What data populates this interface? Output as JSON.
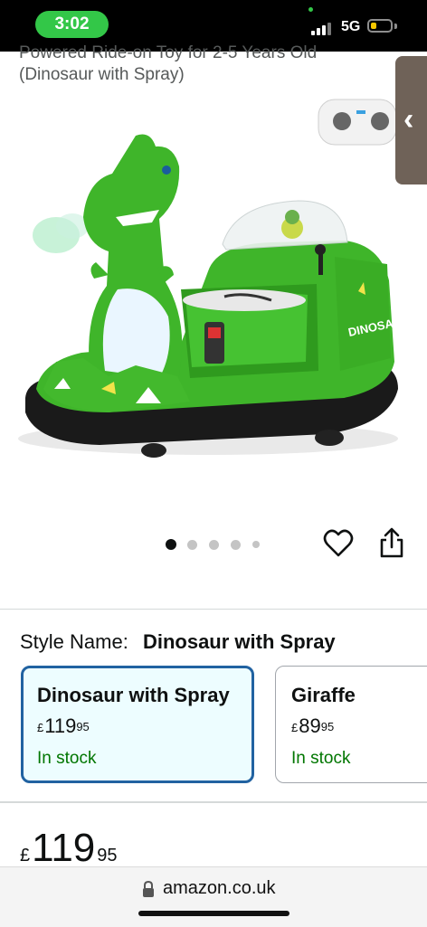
{
  "status_bar": {
    "time": "3:02",
    "network": "5G",
    "battery_level": 0.3
  },
  "product": {
    "title_clipped": "Powered Ride-on Toy for 2-5 Years Old",
    "title_line": "(Dinosaur with Spray)",
    "carousel": {
      "dot_count": 5,
      "active_index": 0
    }
  },
  "actions": {
    "wishlist_icon": "heart-icon",
    "share_icon": "share-icon"
  },
  "style_selector": {
    "label": "Style Name:",
    "selected_value": "Dinosaur with Spray",
    "options": [
      {
        "name": "Dinosaur with Spray",
        "currency": "£",
        "price_whole": "119",
        "price_fraction": "95",
        "availability": "In stock",
        "selected": true
      },
      {
        "name": "Giraffe",
        "currency": "£",
        "price_whole": "89",
        "price_fraction": "95",
        "availability": "In stock",
        "selected": false
      }
    ]
  },
  "price": {
    "currency": "£",
    "whole": "119",
    "fraction": "95"
  },
  "browser": {
    "url": "amazon.co.uk"
  },
  "colors": {
    "accent_blue": "#2162a1",
    "stock_green": "#007600",
    "status_green": "#33c748",
    "selected_bg": "#edfdff"
  }
}
